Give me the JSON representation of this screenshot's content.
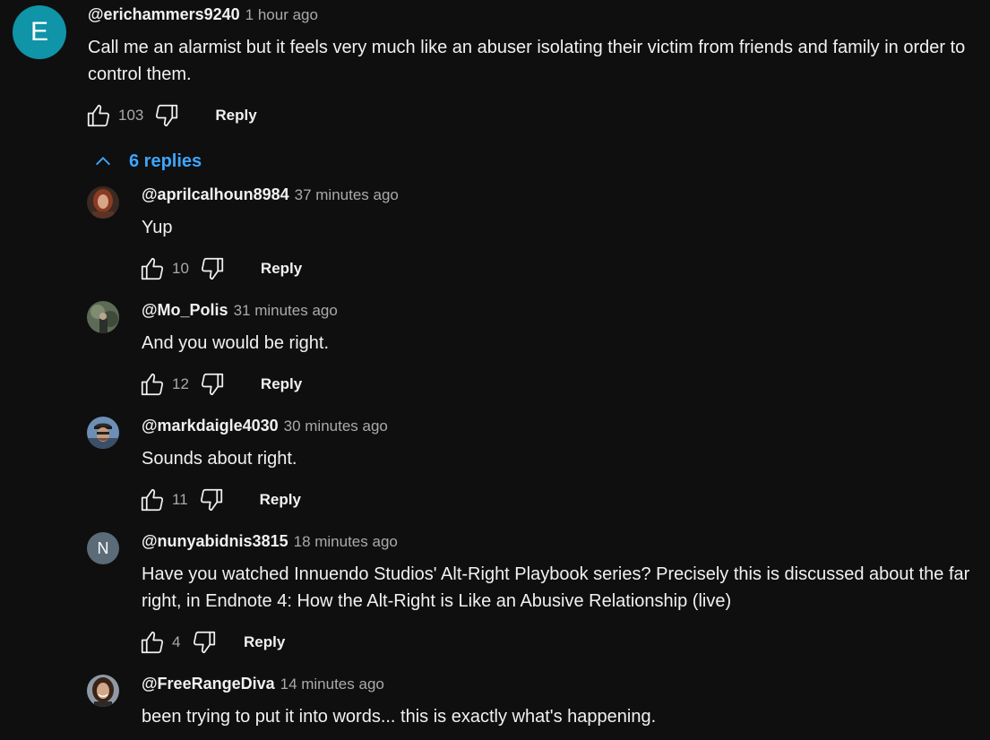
{
  "top_comment": {
    "avatar_letter": "E",
    "author": "@erichammers9240",
    "time": "1 hour ago",
    "text": "Call me an alarmist but it feels very much like an abuser isolating their victim from friends and family in order to control them.",
    "likes": "103",
    "reply_label": "Reply"
  },
  "replies_toggle": {
    "label": "6 replies",
    "icon": "chevron-up-icon"
  },
  "replies": [
    {
      "author": "@aprilcalhoun8984",
      "time": "37 minutes ago",
      "text": "Yup",
      "likes": "10",
      "reply_label": "Reply"
    },
    {
      "author": "@Mo_Polis",
      "time": "31 minutes ago",
      "text": "And you would be right.",
      "likes": "12",
      "reply_label": "Reply"
    },
    {
      "author": "@markdaigle4030",
      "time": "30 minutes ago",
      "text": "Sounds about right.",
      "likes": "11",
      "reply_label": "Reply"
    },
    {
      "avatar_letter": "N",
      "author": "@nunyabidnis3815",
      "time": "18 minutes ago",
      "text": "Have you watched Innuendo Studios' Alt-Right Playbook series? Precisely this is discussed about the far right, in Endnote 4: How the Alt-Right is Like an Abusive Relationship (live)",
      "likes": "4",
      "reply_label": "Reply"
    },
    {
      "author": "@FreeRangeDiva",
      "time": "14 minutes ago",
      "text": "been trying to put it into words... this is exactly what's happening."
    }
  ],
  "colors": {
    "background": "#0f0f0f",
    "link": "#3ea6ff",
    "avatar_e": "#0f94a8",
    "avatar_n": "#5b6b78"
  }
}
